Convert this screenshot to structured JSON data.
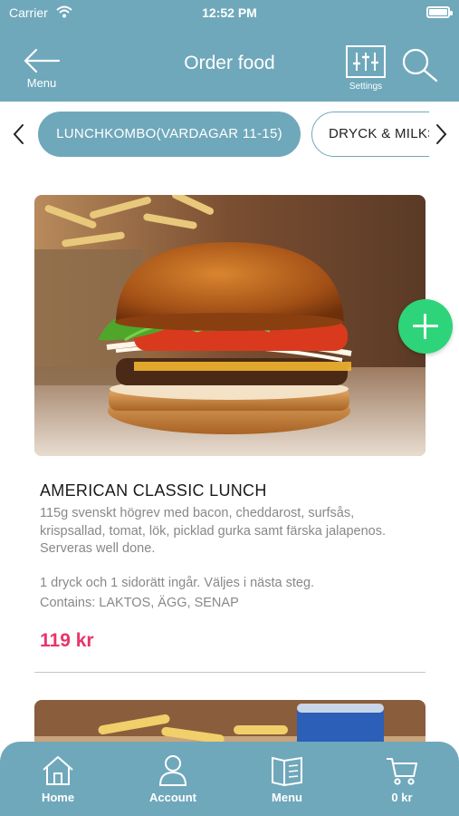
{
  "status_bar": {
    "carrier": "Carrier",
    "time": "12:52 PM"
  },
  "header": {
    "back_label": "Menu",
    "title": "Order food",
    "settings_label": "Settings"
  },
  "categories": {
    "active": "LUNCHKOMBO(VARDAGAR 11-15)",
    "next": "DRYCK & MILKSHAKE"
  },
  "product": {
    "name": "AMERICAN CLASSIC LUNCH",
    "description": "115g svenskt högrev med bacon, cheddarost, surfsås, krispsallad, tomat, lök, picklad gurka samt färska jalapenos. Serveras well done.",
    "included": "1 dryck och 1 sidorätt ingår. Väljes i nästa steg.",
    "contains": "Contains: LAKTOS, ÄGG, SENAP",
    "price": "119 kr"
  },
  "tabbar": {
    "home": "Home",
    "account": "Account",
    "menu": "Menu",
    "cart": "0 kr"
  },
  "colors": {
    "brand": "#6fa8bb",
    "price": "#e8356a",
    "add_button": "#2ed47a"
  },
  "icons": [
    "wifi-icon",
    "battery-icon",
    "back-arrow-icon",
    "sliders-icon",
    "search-icon",
    "chevron-left-icon",
    "chevron-right-icon",
    "plus-icon",
    "home-icon",
    "user-icon",
    "book-icon",
    "cart-icon"
  ]
}
